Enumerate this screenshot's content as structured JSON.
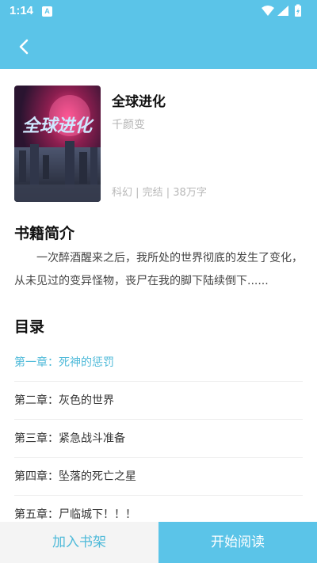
{
  "status_bar": {
    "time": "1:14",
    "notification_glyph": "A",
    "icons": [
      "wifi-icon",
      "signal-icon",
      "battery-charging-icon"
    ]
  },
  "header": {
    "back_icon": "chevron-left-icon",
    "color": "#5bc4e8"
  },
  "book": {
    "title": "全球进化",
    "author": "千颜变",
    "meta": "科幻 | 完结 | 38万字",
    "cover": {
      "title_art": "全球进化"
    }
  },
  "intro": {
    "heading": "书籍简介",
    "text": "一次醉酒醒来之后，我所处的世界彻底的发生了变化，从未见过的变异怪物，丧尸在我的脚下陆续倒下......"
  },
  "toc": {
    "heading": "目录",
    "chapters": [
      {
        "label": "第一章：死神的惩罚",
        "active": true
      },
      {
        "label": "第二章：灰色的世界",
        "active": false
      },
      {
        "label": "第三章：紧急战斗准备",
        "active": false
      },
      {
        "label": "第四章：坠落的死亡之星",
        "active": false
      },
      {
        "label": "第五章：尸临城下！！！",
        "active": false
      }
    ]
  },
  "actions": {
    "add_to_shelf": "加入书架",
    "start_reading": "开始阅读"
  },
  "colors": {
    "accent": "#5bc4e8",
    "accent_text": "#4fbad9"
  }
}
